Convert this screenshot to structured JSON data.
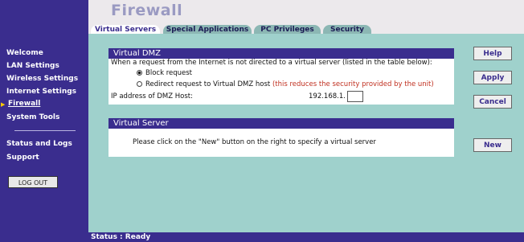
{
  "title": "Firewall",
  "tabs": [
    {
      "label": "Virtual Servers"
    },
    {
      "label": "Special Applications"
    },
    {
      "label": "PC Privileges"
    },
    {
      "label": "Security"
    }
  ],
  "sidebar": {
    "items": [
      {
        "label": "Welcome"
      },
      {
        "label": "LAN Settings"
      },
      {
        "label": "Wireless Settings"
      },
      {
        "label": "Internet Settings"
      },
      {
        "label": "Firewall"
      },
      {
        "label": "System Tools"
      },
      {
        "label": "Status and Logs"
      },
      {
        "label": "Support"
      }
    ],
    "logout_label": "LOG OUT",
    "active_item": "Firewall"
  },
  "virtual_dmz": {
    "heading": "Virtual DMZ",
    "description": "When a request from the Internet is not directed to a virtual server (listed in the table below):",
    "option_block": "Block request",
    "option_redirect": "Redirect request to Virtual DMZ host",
    "option_redirect_warning": "(this reduces the security provided by the unit)",
    "selected_option": "Block request",
    "ip_label": "IP address of DMZ Host:",
    "ip_prefix": "192.168.1.",
    "ip_value": ""
  },
  "virtual_server": {
    "heading": "Virtual Server",
    "message": "Please click on the \"New\" button on the right to specify a virtual server"
  },
  "buttons": {
    "help": "Help",
    "apply": "Apply",
    "cancel": "Cancel",
    "new": "New"
  },
  "status": "Status : Ready",
  "colors": {
    "nav_bg": "#3a2d8e",
    "content_bg": "#9fd1cc",
    "tab_bg": "#8cb7b4",
    "warning_text": "#c03020",
    "title_text": "#9a9ac2"
  }
}
